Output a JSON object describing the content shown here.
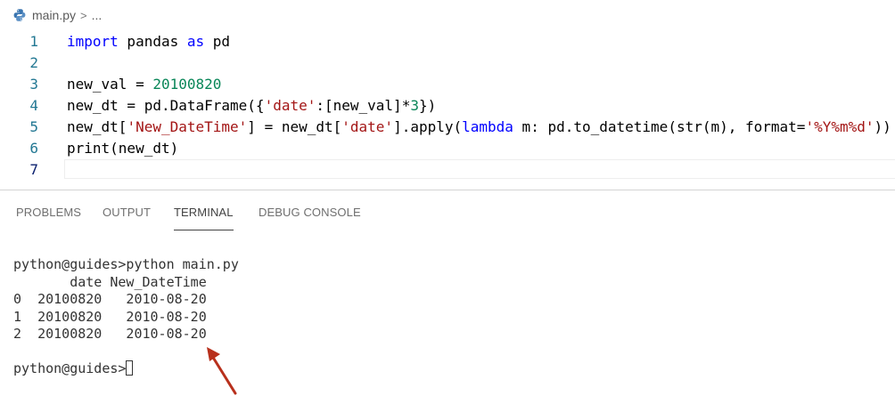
{
  "breadcrumb": {
    "file": "main.py",
    "separator": ">",
    "ellipsis": "..."
  },
  "editor": {
    "lines": [
      {
        "num": "1",
        "tokens": [
          {
            "t": "import",
            "c": "kw"
          },
          {
            "t": " pandas "
          },
          {
            "t": "as",
            "c": "kw"
          },
          {
            "t": " pd"
          }
        ]
      },
      {
        "num": "2",
        "tokens": []
      },
      {
        "num": "3",
        "tokens": [
          {
            "t": "new_val = "
          },
          {
            "t": "20100820",
            "c": "num"
          }
        ]
      },
      {
        "num": "4",
        "tokens": [
          {
            "t": "new_dt = pd.DataFrame({"
          },
          {
            "t": "'date'",
            "c": "str"
          },
          {
            "t": ":[new_val]*"
          },
          {
            "t": "3",
            "c": "num"
          },
          {
            "t": "})"
          }
        ]
      },
      {
        "num": "5",
        "tokens": [
          {
            "t": "new_dt["
          },
          {
            "t": "'New_DateTime'",
            "c": "str"
          },
          {
            "t": "] = new_dt["
          },
          {
            "t": "'date'",
            "c": "str"
          },
          {
            "t": "].apply("
          },
          {
            "t": "lambda",
            "c": "kw"
          },
          {
            "t": " m: pd.to_datetime(str(m), format="
          },
          {
            "t": "'%Y%m%d'",
            "c": "str"
          },
          {
            "t": "))"
          }
        ]
      },
      {
        "num": "6",
        "tokens": [
          {
            "t": "print(new_dt)"
          }
        ]
      },
      {
        "num": "7",
        "tokens": []
      }
    ]
  },
  "panel": {
    "tabs": [
      {
        "label": "PROBLEMS",
        "active": false
      },
      {
        "label": "OUTPUT",
        "active": false
      },
      {
        "label": "TERMINAL",
        "active": true
      },
      {
        "label": "DEBUG CONSOLE",
        "active": false
      }
    ]
  },
  "terminal": {
    "command_line": "python@guides>python main.py",
    "header": "       date New_DateTime",
    "rows": [
      "0  20100820   2010-08-20",
      "1  20100820   2010-08-20",
      "2  20100820   2010-08-20"
    ],
    "blank": "",
    "prompt": "python@guides>"
  },
  "colors": {
    "annotation_arrow": "#b8301c",
    "keyword": "#0000ff",
    "number": "#098658",
    "string": "#a31515"
  }
}
